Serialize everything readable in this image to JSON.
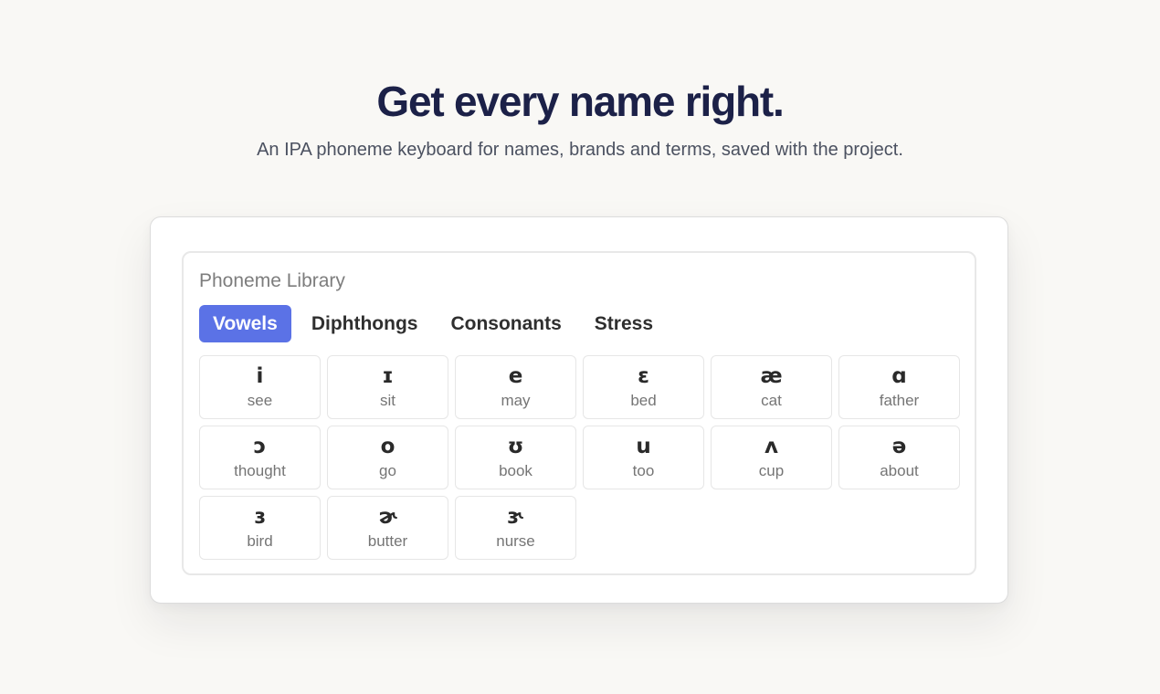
{
  "hero": {
    "title": "Get every name right.",
    "subtitle": "An IPA phoneme keyboard for names, brands and terms, saved with the project."
  },
  "library": {
    "title": "Phoneme Library",
    "active_tab": "Vowels",
    "accent_color": "#5b72e6",
    "tabs": [
      {
        "label": "Vowels",
        "active": true
      },
      {
        "label": "Diphthongs",
        "active": false
      },
      {
        "label": "Consonants",
        "active": false
      },
      {
        "label": "Stress",
        "active": false
      }
    ],
    "phonemes": [
      {
        "symbol": "i",
        "word": "see"
      },
      {
        "symbol": "ɪ",
        "word": "sit"
      },
      {
        "symbol": "e",
        "word": "may"
      },
      {
        "symbol": "ɛ",
        "word": "bed"
      },
      {
        "symbol": "æ",
        "word": "cat"
      },
      {
        "symbol": "ɑ",
        "word": "father"
      },
      {
        "symbol": "ɔ",
        "word": "thought"
      },
      {
        "symbol": "o",
        "word": "go"
      },
      {
        "symbol": "ʊ",
        "word": "book"
      },
      {
        "symbol": "u",
        "word": "too"
      },
      {
        "symbol": "ʌ",
        "word": "cup"
      },
      {
        "symbol": "ə",
        "word": "about"
      },
      {
        "symbol": "ɜ",
        "word": "bird"
      },
      {
        "symbol": "ɚ",
        "word": "butter"
      },
      {
        "symbol": "ɝ",
        "word": "nurse"
      }
    ]
  }
}
